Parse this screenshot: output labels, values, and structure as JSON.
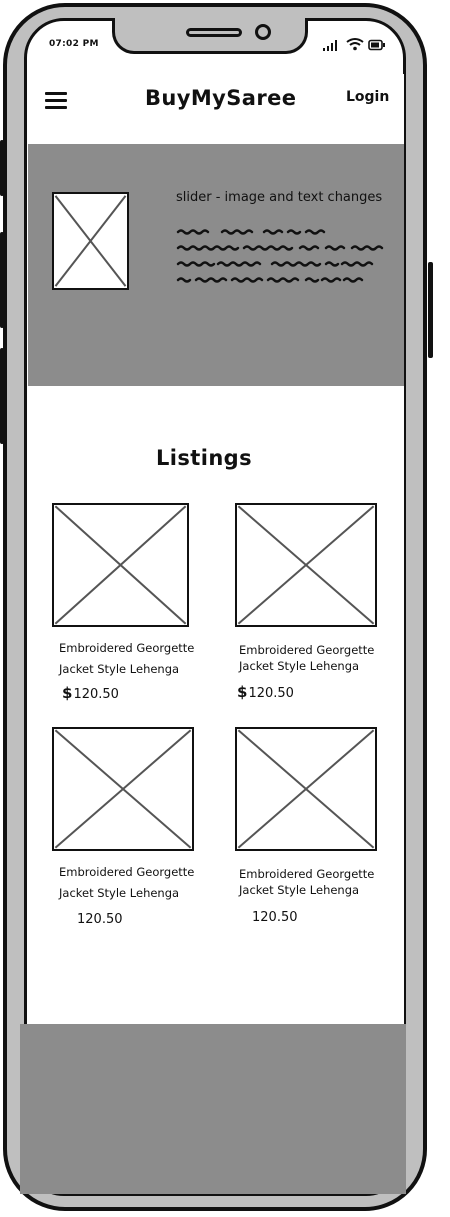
{
  "status_bar": {
    "time": "07:02 PM"
  },
  "header": {
    "brand": "BuyMySaree",
    "login_label": "Login"
  },
  "hero": {
    "title": "slider - image and text changes"
  },
  "listings": {
    "title": "Listings",
    "items": [
      {
        "name_line1": "Embroidered Georgette",
        "name_line2": "Jacket Style Lehenga",
        "currency": "$",
        "price": "120.50"
      },
      {
        "name_line1": "Embroidered Georgette",
        "name_line2": "Jacket Style Lehenga",
        "currency": "$",
        "price": "120.50"
      },
      {
        "name_line1": "Embroidered Georgette",
        "name_line2": "Jacket Style Lehenga",
        "currency": "",
        "price": "120.50"
      },
      {
        "name_line1": "Embroidered Georgette",
        "name_line2": "Jacket Style Lehenga",
        "currency": "",
        "price": "120.50"
      }
    ]
  },
  "icons": [
    "menu-icon",
    "signal-icon",
    "wifi-icon",
    "battery-icon",
    "image-placeholder-icon"
  ],
  "colors": {
    "frame": "#bfbfbf",
    "band": "#8c8c8c",
    "ink": "#111111"
  }
}
